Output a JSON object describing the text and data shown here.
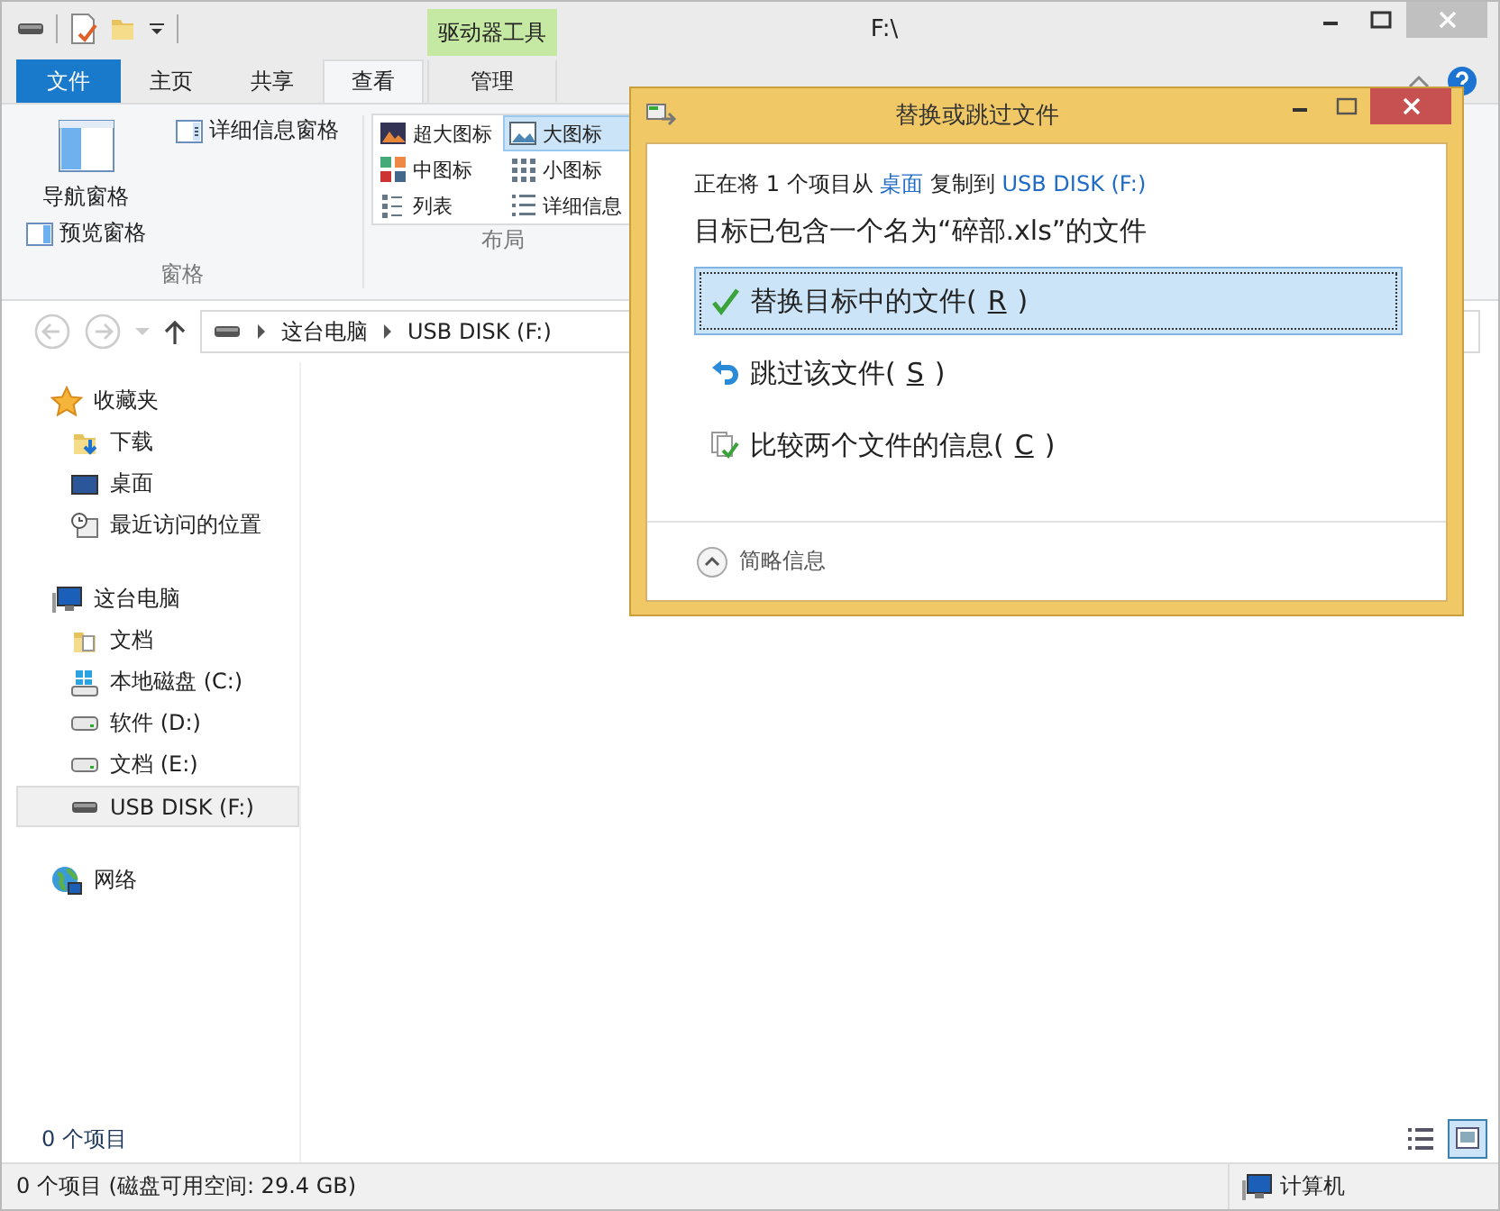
{
  "window": {
    "title": "F:\\"
  },
  "ribbon": {
    "context_header": "驱动器工具",
    "tabs": [
      {
        "label": "文件",
        "kind": "file",
        "selected": false
      },
      {
        "label": "主页",
        "kind": "normal",
        "selected": false
      },
      {
        "label": "共享",
        "kind": "normal",
        "selected": false
      },
      {
        "label": "查看",
        "kind": "normal",
        "selected": true
      },
      {
        "label": "管理",
        "kind": "context",
        "selected": false
      }
    ],
    "panes_group": {
      "label": "窗格",
      "large": "导航窗格",
      "small": [
        "预览窗格",
        "详细信息窗格"
      ]
    },
    "layout_group": {
      "label": "布局",
      "items": [
        {
          "label": "超大图标",
          "selected": false
        },
        {
          "label": "大图标",
          "selected": true
        },
        {
          "label": "中图标",
          "selected": false
        },
        {
          "label": "小图标",
          "selected": false
        },
        {
          "label": "列表",
          "selected": false
        },
        {
          "label": "详细信息",
          "selected": false
        }
      ]
    }
  },
  "address": {
    "crumbs": [
      "这台电脑",
      "USB DISK (F:)"
    ]
  },
  "navigation": [
    {
      "label": "收藏夹",
      "selected": false,
      "children": [
        {
          "label": "下载",
          "selected": false
        },
        {
          "label": "桌面",
          "selected": false
        },
        {
          "label": "最近访问的位置",
          "selected": false
        }
      ]
    },
    {
      "label": "这台电脑",
      "selected": false,
      "children": [
        {
          "label": "文档",
          "selected": false
        },
        {
          "label": "本地磁盘 (C:)",
          "selected": false
        },
        {
          "label": "软件 (D:)",
          "selected": false
        },
        {
          "label": "文档 (E:)",
          "selected": false
        },
        {
          "label": "USB DISK (F:)",
          "selected": true
        }
      ]
    },
    {
      "label": "网络",
      "selected": false
    }
  ],
  "content": {
    "item_count": "0 个项目",
    "view_buttons": [
      {
        "selected": false
      },
      {
        "selected": true
      }
    ]
  },
  "status_bar": {
    "summary": "0 个项目 (磁盘可用空间: 29.4 GB)",
    "zone": "计算机"
  },
  "dialog": {
    "title": "替换或跳过文件",
    "copy_line": [
      {
        "text": "正在将 1 个项目从 ",
        "link": false
      },
      {
        "text": "桌面",
        "link": true
      },
      {
        "text": " 复制到 ",
        "link": false
      },
      {
        "text": "USB DISK (F:)",
        "link": true
      }
    ],
    "message": "目标已包含一个名为“碎部.xls”的文件",
    "options": [
      {
        "before": "替换目标中的文件(",
        "key": "R",
        "after": ")",
        "selected": true
      },
      {
        "before": "跳过该文件(",
        "key": "S",
        "after": ")",
        "selected": false
      },
      {
        "before": "比较两个文件的信息(",
        "key": "C",
        "after": ")",
        "selected": false
      }
    ],
    "details_toggle": "简略信息"
  }
}
